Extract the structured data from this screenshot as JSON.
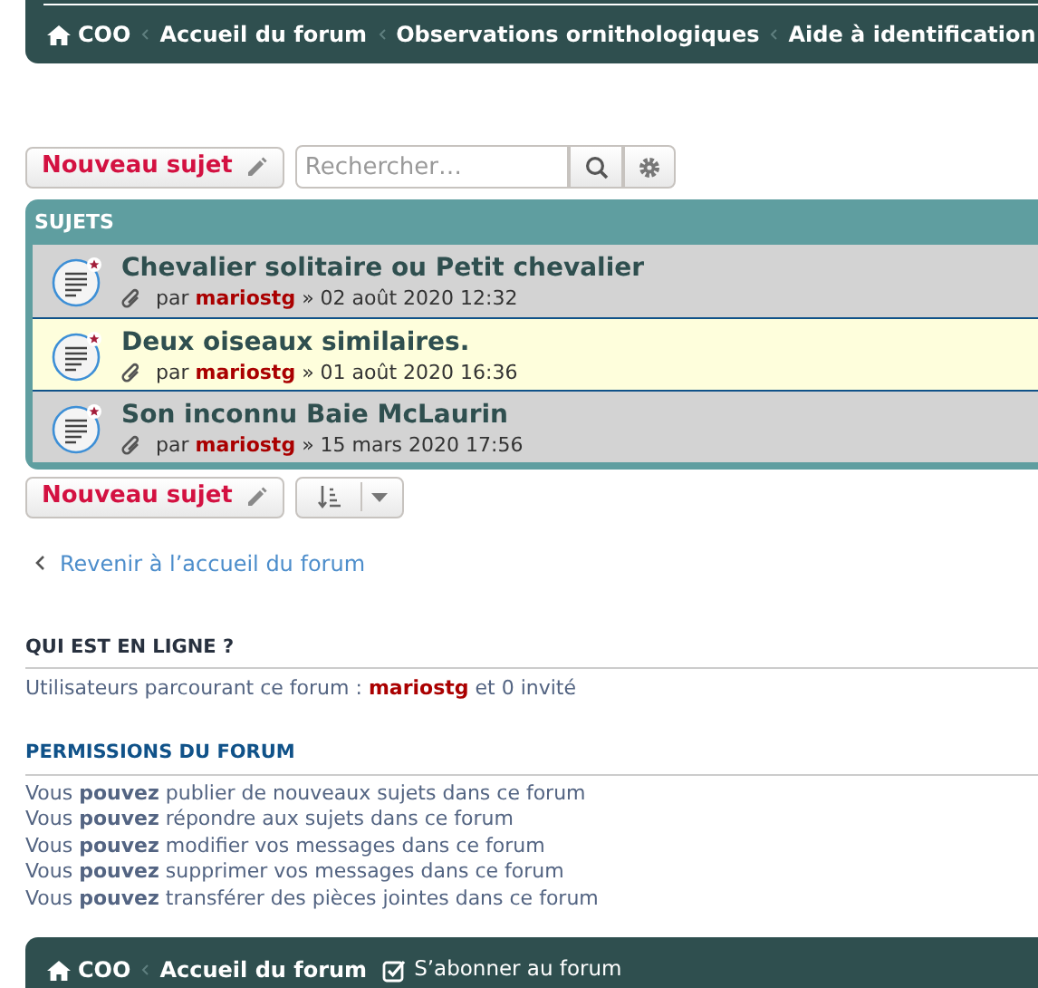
{
  "breadcrumbs": [
    {
      "label": "COO",
      "home": true
    },
    {
      "label": "Accueil du forum",
      "home": false
    },
    {
      "label": "Observations ornithologiques",
      "home": false
    },
    {
      "label": "Aide à identification",
      "home": false
    }
  ],
  "new_topic_button": "Nouveau sujet",
  "search": {
    "placeholder": "Rechercher…"
  },
  "topics": {
    "header": "SUJETS",
    "rows": [
      {
        "title": "Chevalier solitaire ou Petit chevalier",
        "by": "par",
        "author": "mariostg",
        "date": "» 02 août 2020 12:32",
        "highlighted": false,
        "attachment": true
      },
      {
        "title": "Deux oiseaux similaires.",
        "by": "par",
        "author": "mariostg",
        "date": "» 01 août 2020 16:36",
        "highlighted": true,
        "attachment": true
      },
      {
        "title": "Son inconnu Baie McLaurin",
        "by": "par",
        "author": "mariostg",
        "date": "» 15 mars 2020 17:56",
        "highlighted": false,
        "attachment": true
      }
    ]
  },
  "new_topic_button_bottom": "Nouveau sujet",
  "back_link": "Revenir à l’accueil du forum",
  "online": {
    "title": "QUI EST EN LIGNE ?",
    "text": "Utilisateurs parcourant ce forum :",
    "user": "mariostg",
    "rest": "et 0 invité"
  },
  "permissions": {
    "title": "PERMISSIONS DU FORUM",
    "lines": [
      "Vous **pouvez** publier de nouveaux sujets dans ce forum",
      "Vous **pouvez** répondre aux sujets dans ce forum",
      "Vous **pouvez** modifier vos messages dans ce forum",
      "Vous **pouvez** supprimer vos messages dans ce forum",
      "Vous **pouvez** transférer des pièces jointes dans ce forum"
    ]
  },
  "footer": {
    "breadcrumbs": [
      {
        "label": "COO",
        "home": true
      },
      {
        "label": "Accueil du forum",
        "home": false
      }
    ],
    "subscribe": "S’abonner au forum"
  }
}
